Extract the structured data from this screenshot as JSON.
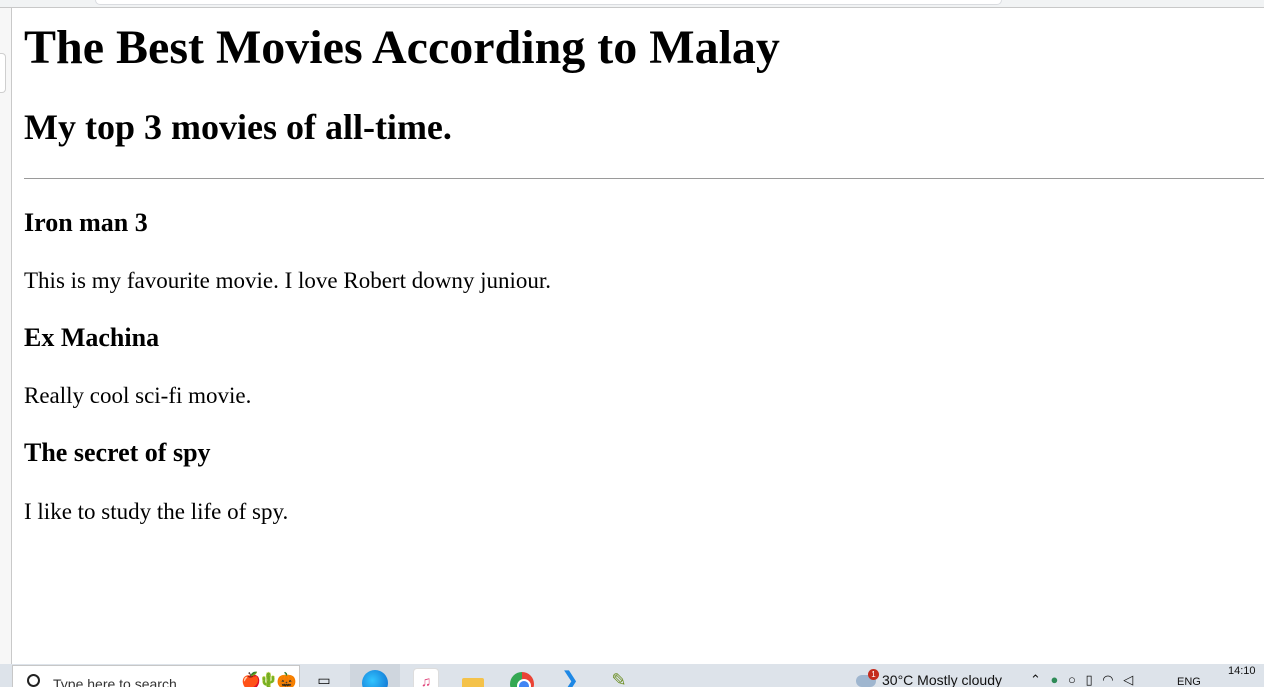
{
  "page": {
    "heading": "The Best Movies According to Malay",
    "subheading": "My top 3 movies of all-time.",
    "movies": [
      {
        "title": "Iron man 3",
        "description": "This is my favourite movie. I love Robert downy juniour."
      },
      {
        "title": "Ex Machina",
        "description": "Really cool sci-fi movie."
      },
      {
        "title": "The secret of spy",
        "description": "I like to study the life of spy."
      }
    ]
  },
  "taskbar": {
    "search_placeholder": "Type here to search",
    "weather_badge": "1",
    "weather": "30°C  Mostly cloudy",
    "language": "ENG",
    "time": "14:10",
    "icons": [
      "search-icon",
      "task-view-icon",
      "edge-icon",
      "itunes-icon",
      "file-explorer-icon",
      "chrome-icon",
      "vscode-icon",
      "paint-icon"
    ]
  }
}
